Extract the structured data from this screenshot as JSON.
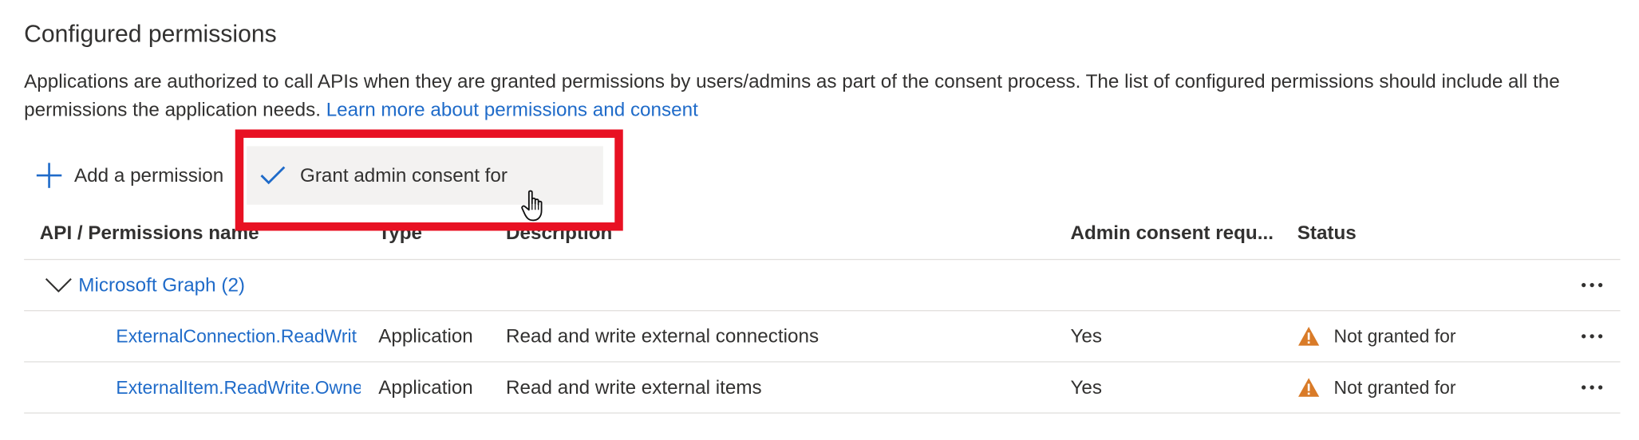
{
  "section": {
    "title": "Configured permissions",
    "description": "Applications are authorized to call APIs when they are granted permissions by users/admins as part of the consent process. The list of configured permissions should include all the permissions the application needs.",
    "learn_more_link": "Learn more about permissions and consent"
  },
  "toolbar": {
    "add_permission_label": "Add a permission",
    "grant_consent_label": "Grant admin consent for"
  },
  "table": {
    "headers": {
      "name": "API / Permissions name",
      "type": "Type",
      "description": "Description",
      "admin_consent": "Admin consent requ...",
      "status": "Status"
    },
    "group": {
      "label": "Microsoft Graph (2)"
    },
    "rows": [
      {
        "name": "ExternalConnection.ReadWrit",
        "type": "Application",
        "description": "Read and write external connections",
        "admin_consent": "Yes",
        "status": "Not granted for"
      },
      {
        "name": "ExternalItem.ReadWrite.Owne",
        "type": "Application",
        "description": "Read and write external items",
        "admin_consent": "Yes",
        "status": "Not granted for"
      }
    ]
  },
  "icons": {
    "add": "plus-icon",
    "grant": "checkmark-icon",
    "expand": "chevron-down-icon",
    "warning": "warning-icon",
    "more": "more-icon",
    "cursor": "hand-cursor-icon"
  },
  "colors": {
    "link": "#1f6bc9",
    "highlight": "#e81123",
    "warning": "#d97b28",
    "grant_bg": "#f3f2f1"
  }
}
